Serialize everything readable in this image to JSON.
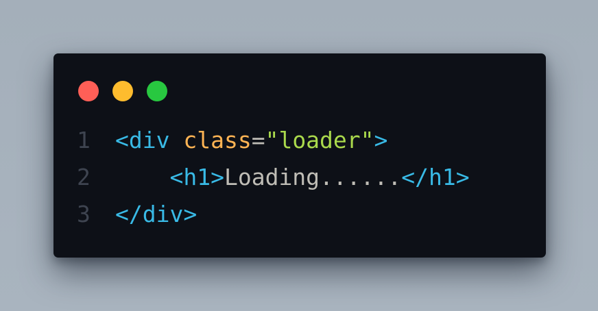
{
  "window": {
    "controls": [
      {
        "name": "close",
        "color": "#ff5f57"
      },
      {
        "name": "minimize",
        "color": "#febc2e"
      },
      {
        "name": "maximize",
        "color": "#28c840"
      }
    ]
  },
  "colors": {
    "tag": "#39bae6",
    "attr": "#ffb454",
    "string": "#aad94c",
    "text": "#bfbdb6",
    "line_number": "#3e4450",
    "background": "#0d1017"
  },
  "code": {
    "lines": [
      {
        "number": "1",
        "tokens": [
          {
            "text": "<div",
            "kind": "tag"
          },
          {
            "text": " ",
            "kind": "text"
          },
          {
            "text": "class",
            "kind": "attr"
          },
          {
            "text": "=",
            "kind": "text"
          },
          {
            "text": "\"loader\"",
            "kind": "string"
          },
          {
            "text": ">",
            "kind": "tag"
          }
        ]
      },
      {
        "number": "2",
        "tokens": [
          {
            "text": "    ",
            "kind": "text"
          },
          {
            "text": "<h1>",
            "kind": "tag"
          },
          {
            "text": "Loading......",
            "kind": "text"
          },
          {
            "text": "</h1>",
            "kind": "tag"
          }
        ]
      },
      {
        "number": "3",
        "tokens": [
          {
            "text": "</div>",
            "kind": "tag"
          }
        ]
      }
    ]
  }
}
